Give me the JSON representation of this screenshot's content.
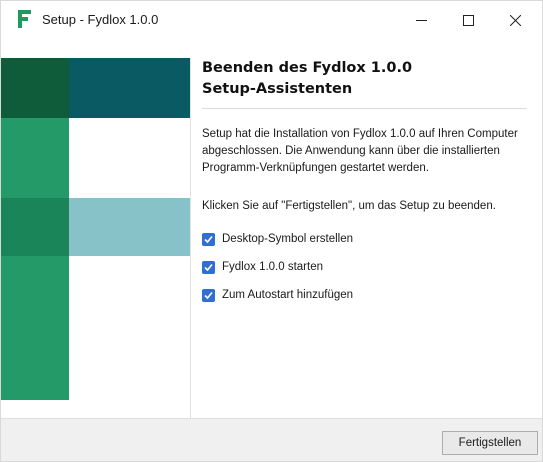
{
  "window": {
    "title": "Setup - Fydlox 1.0.0",
    "logo_icon": "fydlox-logo-icon",
    "controls": {
      "minimize_icon": "minimize-icon",
      "maximize_icon": "maximize-icon",
      "close_icon": "close-icon"
    }
  },
  "colors": {
    "brand_dark_green": "#0f5c3a",
    "brand_green": "#239a68",
    "brand_teal_dark": "#0a5a63",
    "brand_teal_light": "#86c2c8",
    "checkbox_blue": "#2f6fd0"
  },
  "content": {
    "heading_line1": "Beenden des Fydlox 1.0.0",
    "heading_line2": "Setup-Assistenten",
    "paragraph1": "Setup hat die Installation von Fydlox 1.0.0 auf Ihren Computer abgeschlossen. Die Anwendung kann über die installierten Programm-Verknüpfungen gestartet werden.",
    "paragraph2": "Klicken Sie auf \"Fertigstellen\", um das Setup zu beenden.",
    "options": [
      {
        "label": "Desktop-Symbol erstellen",
        "checked": true
      },
      {
        "label": "Fydlox 1.0.0 starten",
        "checked": true
      },
      {
        "label": "Zum Autostart hinzufügen",
        "checked": true
      }
    ]
  },
  "footer": {
    "finish_label": "Fertigstellen"
  }
}
